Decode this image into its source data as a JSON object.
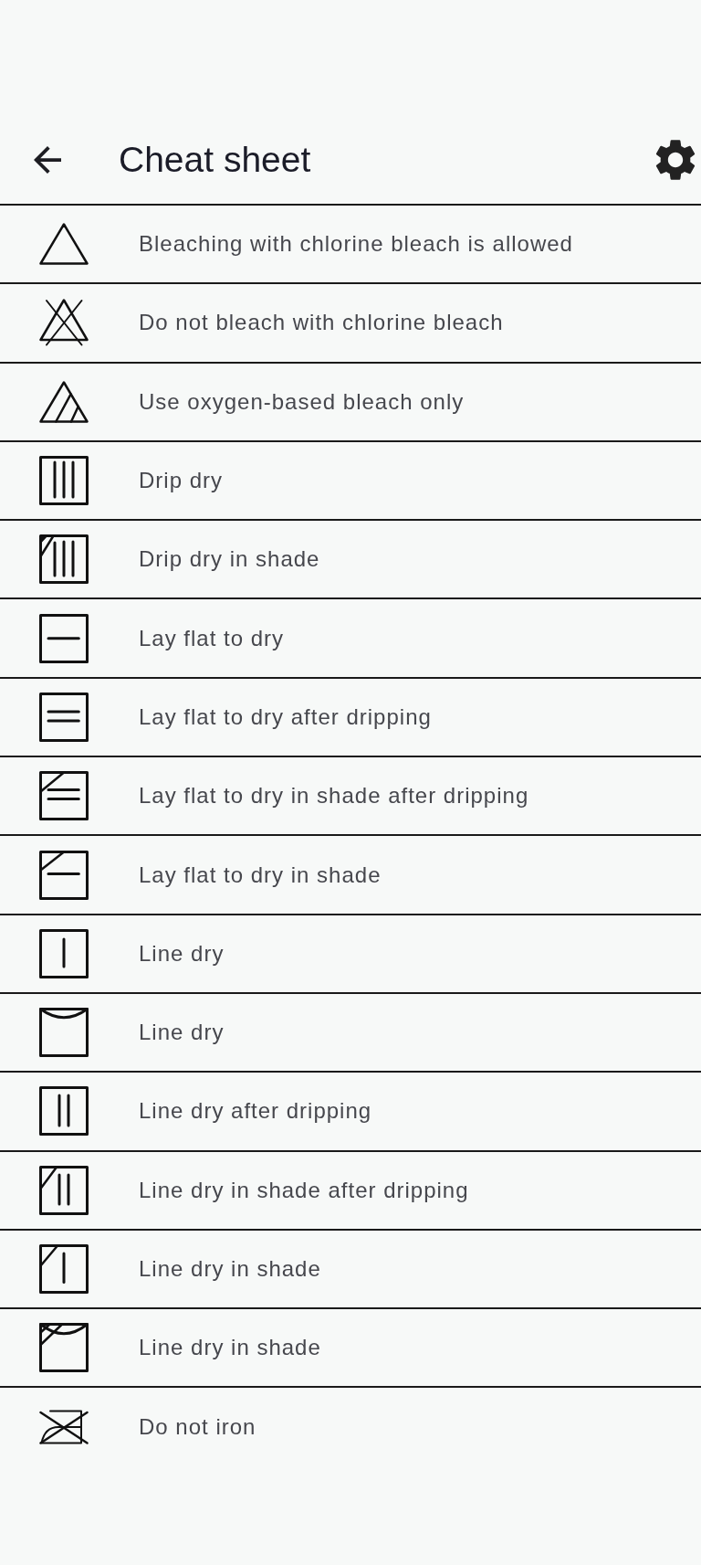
{
  "app_bar": {
    "title": "Cheat sheet"
  },
  "symbols": [
    {
      "kind": "bleach",
      "description": "Bleaching with chlorine bleach is allowed"
    },
    {
      "kind": "nobleach",
      "description": "Do not bleach with chlorine bleach"
    },
    {
      "kind": "oxygen",
      "description": "Use oxygen-based bleach only"
    },
    {
      "kind": "drip",
      "description": "Drip dry"
    },
    {
      "kind": "dripshade",
      "description": "Drip dry in shade"
    },
    {
      "kind": "flat",
      "description": "Lay flat to dry"
    },
    {
      "kind": "flatdrip",
      "description": "Lay flat to dry after dripping"
    },
    {
      "kind": "flatdripshade",
      "description": "Lay flat to dry in shade after dripping"
    },
    {
      "kind": "flatshade",
      "description": "Lay flat to dry in shade"
    },
    {
      "kind": "line",
      "description": "Line dry"
    },
    {
      "kind": "hang",
      "description": "Line dry"
    },
    {
      "kind": "linedrip",
      "description": "Line dry after dripping"
    },
    {
      "kind": "linedripshade",
      "description": "Line dry in shade after dripping"
    },
    {
      "kind": "lineshade",
      "description": "Line dry in shade"
    },
    {
      "kind": "hangshade",
      "description": "Line dry in shade"
    },
    {
      "kind": "noiron",
      "description": "Do not iron"
    }
  ]
}
